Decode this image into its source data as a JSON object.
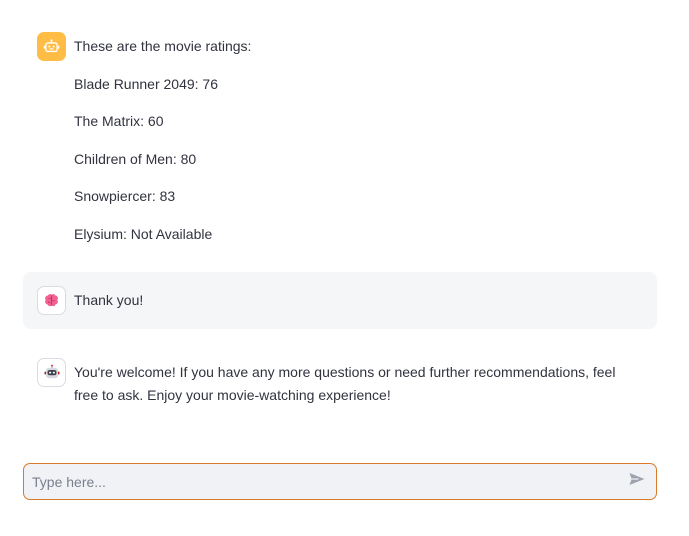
{
  "messages": [
    {
      "role": "assistant",
      "avatar_icon": "robot-icon",
      "lines": [
        "These are the movie ratings:",
        "Blade Runner 2049: 76",
        "The Matrix: 60",
        "Children of Men: 80",
        "Snowpiercer: 83",
        "Elysium: Not Available"
      ]
    },
    {
      "role": "user",
      "avatar_icon": "brain-icon",
      "text": "Thank you!"
    },
    {
      "role": "assistant",
      "avatar_icon": "robot-face-icon",
      "text": "You're welcome! If you have any more questions or need further recommendations, feel free to ask. Enjoy your movie-watching experience!"
    }
  ],
  "chat_input": {
    "placeholder": "Type here...",
    "value": "",
    "send_icon": "send-icon"
  },
  "colors": {
    "accent_bot_avatar": "#ffbd45",
    "input_border": "#d97a2b",
    "user_bubble_bg": "#f5f6f8"
  }
}
